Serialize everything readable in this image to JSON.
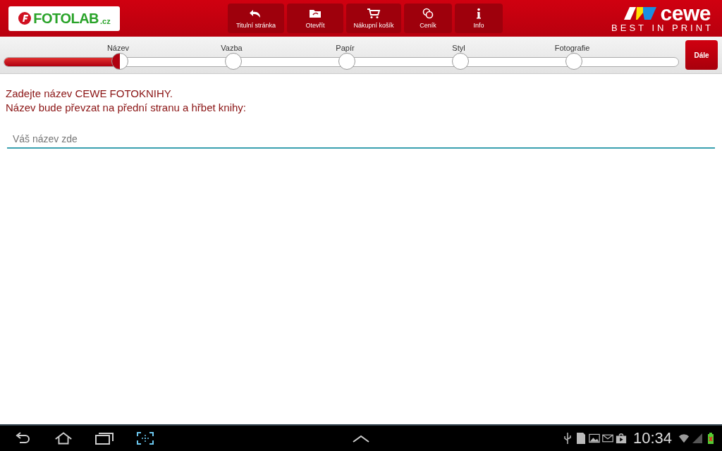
{
  "header": {
    "logo": {
      "name": "FOTOLAB",
      "suffix": ".cz"
    },
    "nav": [
      {
        "label": "Titulní stránka",
        "kind": "undo"
      },
      {
        "label": "Otevřít",
        "kind": "folder"
      },
      {
        "label": "Nákupní košík",
        "kind": "cart"
      },
      {
        "label": "Ceník",
        "kind": "coins"
      },
      {
        "label": "Info",
        "kind": "info"
      }
    ],
    "brand": {
      "name": "cewe",
      "tagline": "BEST IN PRINT"
    }
  },
  "progress": {
    "level": 0.165,
    "steps": [
      {
        "label": "Název",
        "selected": true
      },
      {
        "label": "Vazba",
        "selected": false
      },
      {
        "label": "Papír",
        "selected": false
      },
      {
        "label": "Styl",
        "selected": false
      },
      {
        "label": "Fotografie",
        "selected": false
      }
    ],
    "next_button": "Dále"
  },
  "instructions": [
    "Zadejte název CEWE FOTOKNIHY.",
    "Název bude převzat na přední stranu a hřbet knihy:"
  ],
  "title_field": {
    "placeholder": "Váš název zde"
  },
  "system_bar": {
    "time": "10:34"
  }
}
